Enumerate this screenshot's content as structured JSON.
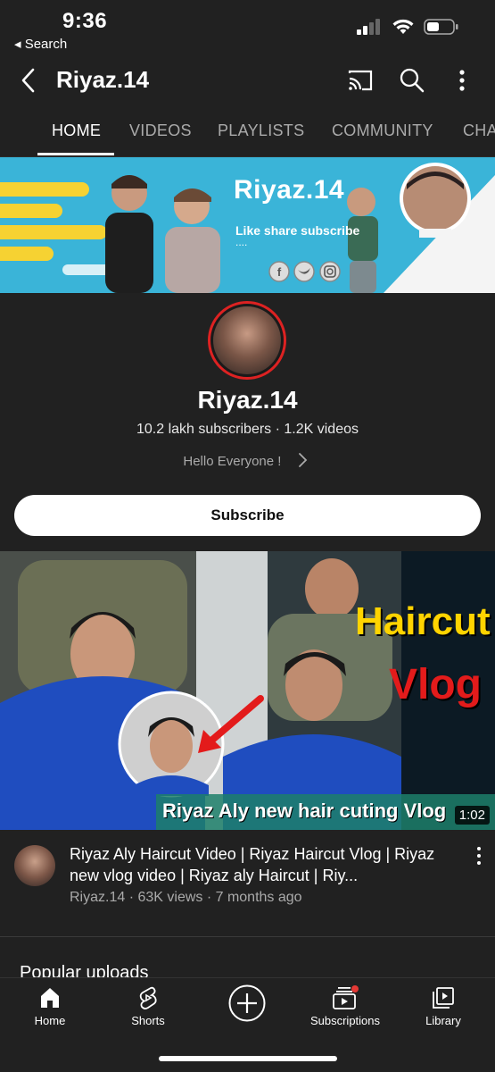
{
  "status_bar": {
    "time": "9:36",
    "back_label": "◂ Search"
  },
  "header": {
    "title": "Riyaz.14"
  },
  "tabs": [
    {
      "label": "HOME",
      "active": true
    },
    {
      "label": "VIDEOS"
    },
    {
      "label": "PLAYLISTS"
    },
    {
      "label": "COMMUNITY"
    },
    {
      "label": "CHA"
    }
  ],
  "banner": {
    "title": "Riyaz.14",
    "tagline": "Like share subscribe",
    "dots": "....",
    "social_icons": [
      "facebook-icon",
      "twitter-icon",
      "instagram-icon"
    ]
  },
  "channel": {
    "name": "Riyaz.14",
    "stats": "10.2 lakh subscribers · 1.2K videos",
    "description": "Hello Everyone !"
  },
  "subscribe_label": "Subscribe",
  "featured_video": {
    "thumbnail_headline_1": "Haircut",
    "thumbnail_headline_2": "Vlog",
    "thumbnail_caption": "Riyaz Aly new hair cuting Vlog",
    "duration": "1:02",
    "title": "Riyaz Aly Haircut Video | Riyaz Haircut  Vlog | Riyaz new vlog video | Riyaz aly Haircut | Riy...",
    "meta": "Riyaz.14 · 63K views · 7 months ago"
  },
  "section_title": "Popular uploads",
  "bottom_nav": [
    {
      "label": "Home",
      "icon": "home-icon"
    },
    {
      "label": "Shorts",
      "icon": "shorts-icon"
    },
    {
      "label": "",
      "icon": "create-icon"
    },
    {
      "label": "Subscriptions",
      "icon": "subscriptions-icon"
    },
    {
      "label": "Library",
      "icon": "library-icon"
    }
  ],
  "colors": {
    "background": "#212121",
    "banner_blue": "#3ab4d8",
    "banner_yellow": "#f6d232",
    "avatar_ring": "#dd2222",
    "thumbnail_yellow": "#ffd400",
    "thumbnail_red": "#e31b1b",
    "notification_dot": "#e53935"
  }
}
